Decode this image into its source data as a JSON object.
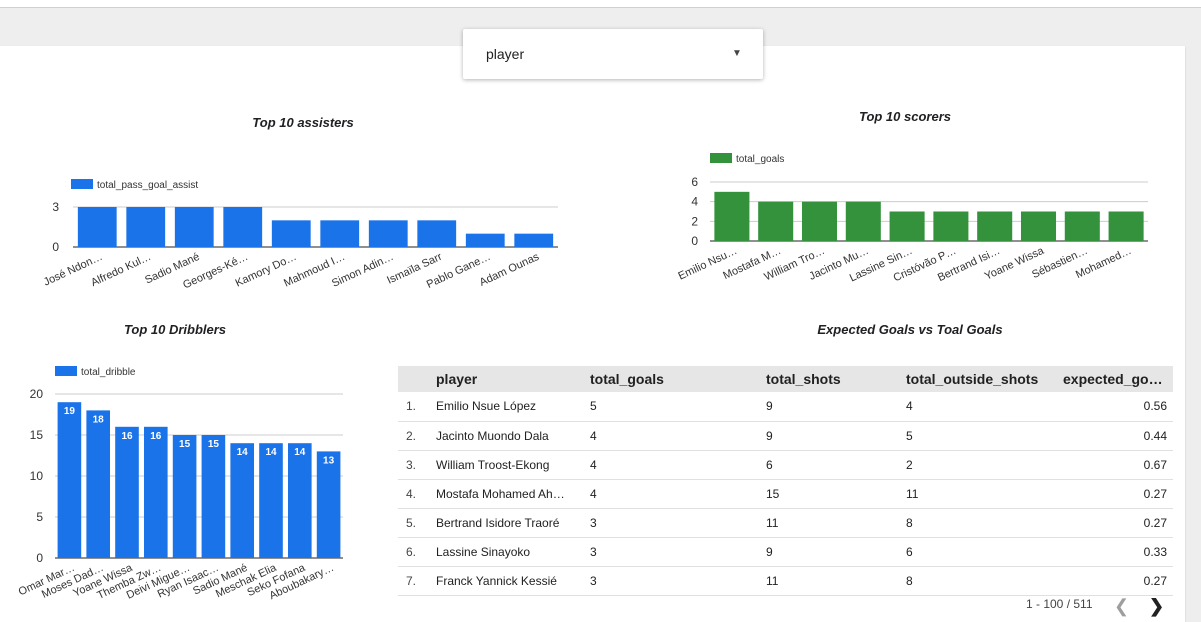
{
  "filter": {
    "label": "player"
  },
  "colors": {
    "blue": "#1a73e8",
    "green": "#34923d"
  },
  "icons": {
    "dropdown": "caret-down-icon",
    "prev": "chevron-left-icon",
    "next": "chevron-right-icon"
  },
  "chart_data": [
    {
      "id": "assisters",
      "type": "bar",
      "title": "Top 10 assisters",
      "categories": [
        "José Ndon…",
        "Alfredo Kul…",
        "Sadio Mané",
        "Georges-Ké…",
        "Kamory Do…",
        "Mahmoud I…",
        "Simon Adin…",
        "Ismaïla Sarr",
        "Pablo Gane…",
        "Adam Ounas"
      ],
      "series": [
        {
          "name": "total_pass_goal_assist",
          "values": [
            3,
            3,
            3,
            3,
            2,
            2,
            2,
            2,
            1,
            1
          ]
        }
      ],
      "ylim": [
        0,
        3
      ],
      "yticks": [
        "0",
        "3"
      ],
      "grid": true,
      "legend": "top-left"
    },
    {
      "id": "scorers",
      "type": "bar",
      "title": "Top 10 scorers",
      "categories": [
        "Emilio Nsu…",
        "Mostafa M…",
        "William Tro…",
        "Jacinto Mu…",
        "Lassine Sin…",
        "Cristóvão P…",
        "Bertrand Isi…",
        "Yoane Wissa",
        "Sébastien…",
        "Mohamed…"
      ],
      "series": [
        {
          "name": "total_goals",
          "values": [
            5,
            4,
            4,
            4,
            3,
            3,
            3,
            3,
            3,
            3
          ]
        }
      ],
      "ylim": [
        0,
        6
      ],
      "yticks": [
        "0",
        "2",
        "4",
        "6"
      ],
      "grid": true,
      "legend": "top-left"
    },
    {
      "id": "dribblers",
      "type": "bar",
      "title": "Top 10 Dribblers",
      "categories": [
        "Omar Mar…",
        "Moses Dad…",
        "Yoane Wissa",
        "Themba Zw…",
        "Deivi Migue…",
        "Ryan Isaac…",
        "Sadio Mané",
        "Meschak Elia",
        "Seko Fofana",
        "Aboubakary…"
      ],
      "series": [
        {
          "name": "total_dribble",
          "values": [
            19,
            18,
            16,
            16,
            15,
            15,
            14,
            14,
            14,
            13
          ]
        }
      ],
      "ylim": [
        0,
        20
      ],
      "yticks": [
        "0",
        "5",
        "10",
        "15",
        "20"
      ],
      "grid": true,
      "legend": "top-left",
      "data_labels": true
    },
    {
      "id": "xg_table",
      "type": "table",
      "title": "Expected Goals vs Toal Goals",
      "columns": [
        "player",
        "total_goals",
        "total_shots",
        "total_outside_shots",
        "expected_goal…"
      ],
      "rows": [
        [
          "1.",
          "Emilio Nsue López",
          "5",
          "9",
          "4",
          "0.56"
        ],
        [
          "2.",
          "Jacinto Muondo Dala",
          "4",
          "9",
          "5",
          "0.44"
        ],
        [
          "3.",
          "William Troost-Ekong",
          "4",
          "6",
          "2",
          "0.67"
        ],
        [
          "4.",
          "Mostafa Mohamed Ah…",
          "4",
          "15",
          "11",
          "0.27"
        ],
        [
          "5.",
          "Bertrand Isidore Traoré",
          "3",
          "11",
          "8",
          "0.27"
        ],
        [
          "6.",
          "Lassine Sinayoko",
          "3",
          "9",
          "6",
          "0.33"
        ],
        [
          "7.",
          "Franck Yannick Kessié",
          "3",
          "11",
          "8",
          "0.27"
        ]
      ],
      "pagination": "1 - 100 / 511"
    }
  ]
}
